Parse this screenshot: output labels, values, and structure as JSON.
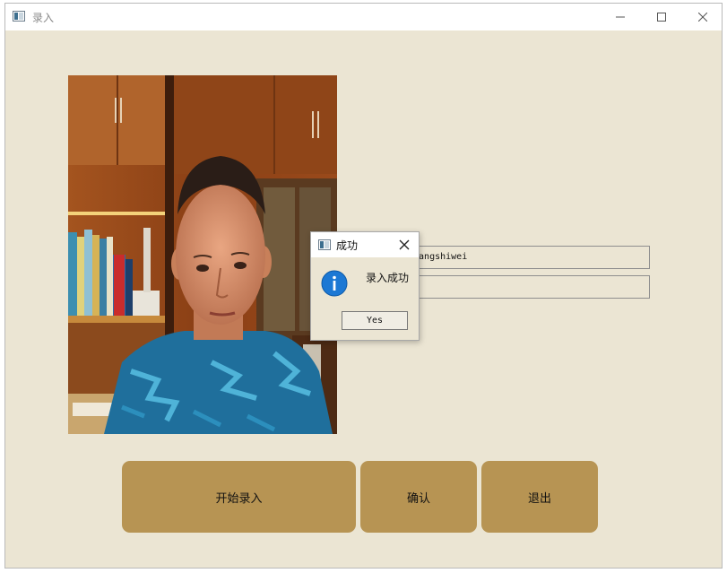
{
  "window": {
    "title": "录入",
    "app_icon": "window-app-icon"
  },
  "form": {
    "name_value": "zhangshiwei",
    "id_value": ""
  },
  "buttons": {
    "start_label": "开始录入",
    "confirm_label": "确认",
    "exit_label": "退出"
  },
  "dialog": {
    "title": "成功",
    "message": "录入成功",
    "yes_label": "Yes",
    "icon": "info-icon"
  },
  "colors": {
    "background": "#ebe5d3",
    "button": "#b79453",
    "info_blue": "#1c78d4"
  }
}
